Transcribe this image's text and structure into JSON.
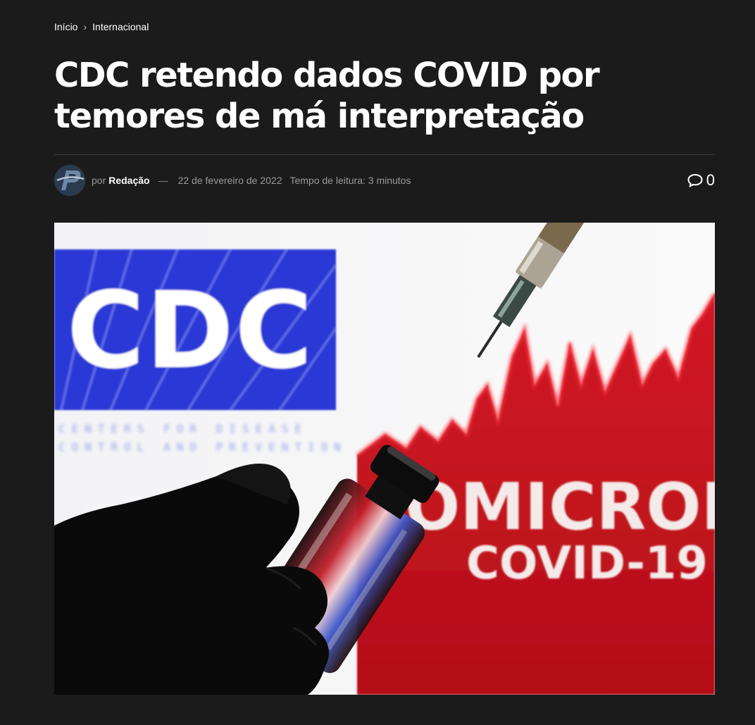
{
  "breadcrumb": {
    "home": "Início",
    "separator": "›",
    "category": "Internacional"
  },
  "article": {
    "title": "CDC retendo dados COVID por temores de má interpretação",
    "by_prefix": "por",
    "author": "Redação",
    "dash": "—",
    "date": "22 de fevereiro de 2022",
    "reading_time": "Tempo de leitura: 3 minutos",
    "comments_count": "0",
    "comment_icon": "speech-bubble-icon"
  },
  "hero_image": {
    "logo_text": "CDC",
    "logo_subtext_line1": "CENTERS FOR DISEASE",
    "logo_subtext_line2": "CONTROL AND PREVENTION",
    "headline_text": "OMICRON",
    "subline_text": "COVID-19"
  },
  "colors": {
    "background": "#1b1b1b",
    "cdc_blue": "#2b39d6",
    "omicron_red": "#c4101c",
    "meta_text": "#9a9a9a"
  }
}
